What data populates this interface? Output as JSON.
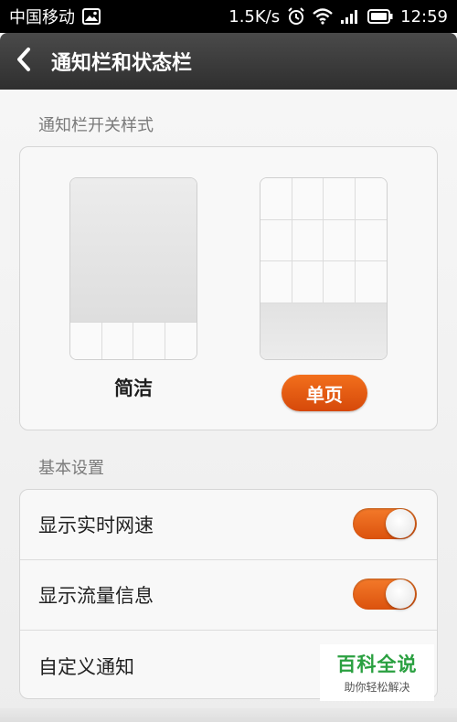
{
  "status_bar": {
    "carrier": "中国移动",
    "speed": "1.5K/s",
    "time": "12:59",
    "icons": [
      "image-notification-icon",
      "alarm-icon",
      "wifi-icon",
      "signal-icon",
      "battery-icon"
    ]
  },
  "header": {
    "title": "通知栏和状态栏",
    "back_icon": "chevron-left-icon"
  },
  "notification_style": {
    "section_label": "通知栏开关样式",
    "options": [
      {
        "label": "简洁",
        "selected": false
      },
      {
        "label": "单页",
        "selected": true
      }
    ],
    "accent_color": "#e85b12"
  },
  "basic_settings": {
    "section_label": "基本设置",
    "items": [
      {
        "label": "显示实时网速",
        "toggle": true
      },
      {
        "label": "显示流量信息",
        "toggle": true
      },
      {
        "label": "自定义通知"
      }
    ]
  },
  "watermark": {
    "title": "百科全说",
    "subtitle": "助你轻松解决"
  }
}
